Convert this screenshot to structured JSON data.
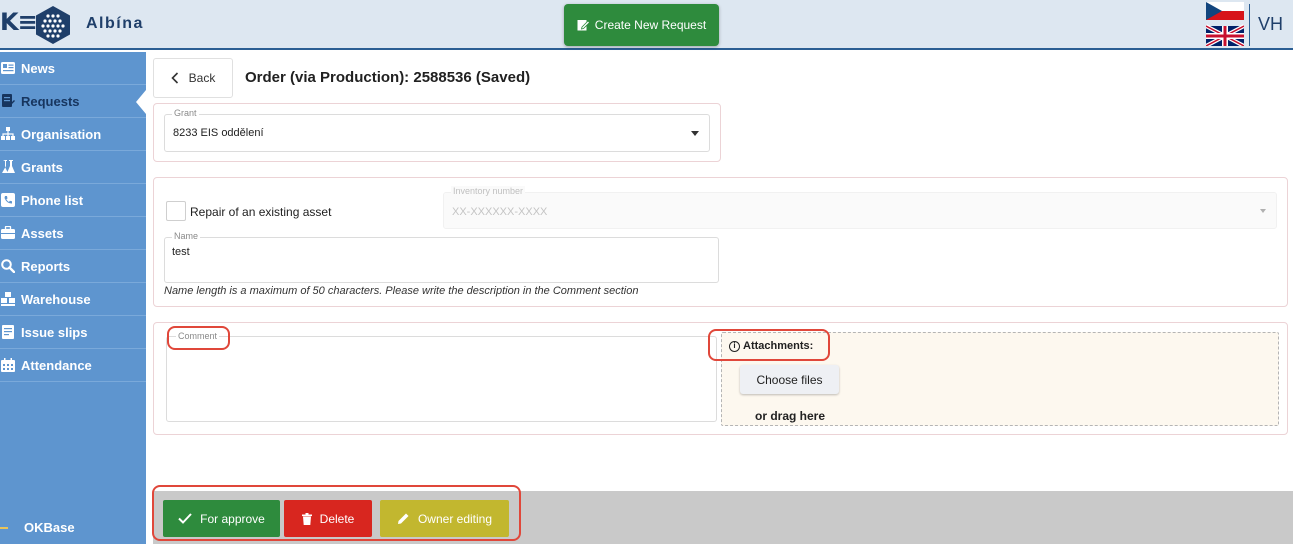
{
  "app": {
    "logo_mark": "K≡",
    "name": "Albína",
    "user_initials": "VH"
  },
  "header": {
    "create_button_label": "Create New Request"
  },
  "sidebar": {
    "items": [
      {
        "label": "News",
        "icon": "newspaper-icon"
      },
      {
        "label": "Requests",
        "icon": "requests-icon",
        "active": true
      },
      {
        "label": "Organisation",
        "icon": "org-chart-icon"
      },
      {
        "label": "Grants",
        "icon": "flask-icon"
      },
      {
        "label": "Phone list",
        "icon": "phone-icon"
      },
      {
        "label": "Assets",
        "icon": "briefcase-icon"
      },
      {
        "label": "Reports",
        "icon": "search-icon"
      },
      {
        "label": "Warehouse",
        "icon": "warehouse-icon"
      },
      {
        "label": "Issue slips",
        "icon": "issue-slip-icon"
      },
      {
        "label": "Attendance",
        "icon": "calendar-icon"
      }
    ],
    "footer_label": "OKBase"
  },
  "page": {
    "back_label": "Back",
    "title": "Order (via Production): 2588536 (Saved)"
  },
  "form": {
    "grant": {
      "label": "Grant",
      "value": "8233 EIS oddělení"
    },
    "repair_checkbox_label": "Repair of an existing asset",
    "inventory": {
      "label": "Inventory number",
      "placeholder": "XX-XXXXXX-XXXX"
    },
    "name": {
      "label": "Name",
      "value": "test"
    },
    "name_hint": "Name length is a maximum of 50 characters. Please write the description in the Comment section",
    "comment": {
      "label": "Comment",
      "value": ""
    },
    "attachments": {
      "title": "Attachments:",
      "choose_label": "Choose files",
      "drag_label": "or drag here"
    }
  },
  "actions": {
    "approve_label": "For approve",
    "delete_label": "Delete",
    "owner_label": "Owner editing"
  },
  "colors": {
    "sidebar": "#5e95cf",
    "primary_green": "#2e8b3d",
    "danger_red": "#d8261f",
    "owner_yellow": "#c2b72f",
    "highlight": "#e0473a"
  }
}
